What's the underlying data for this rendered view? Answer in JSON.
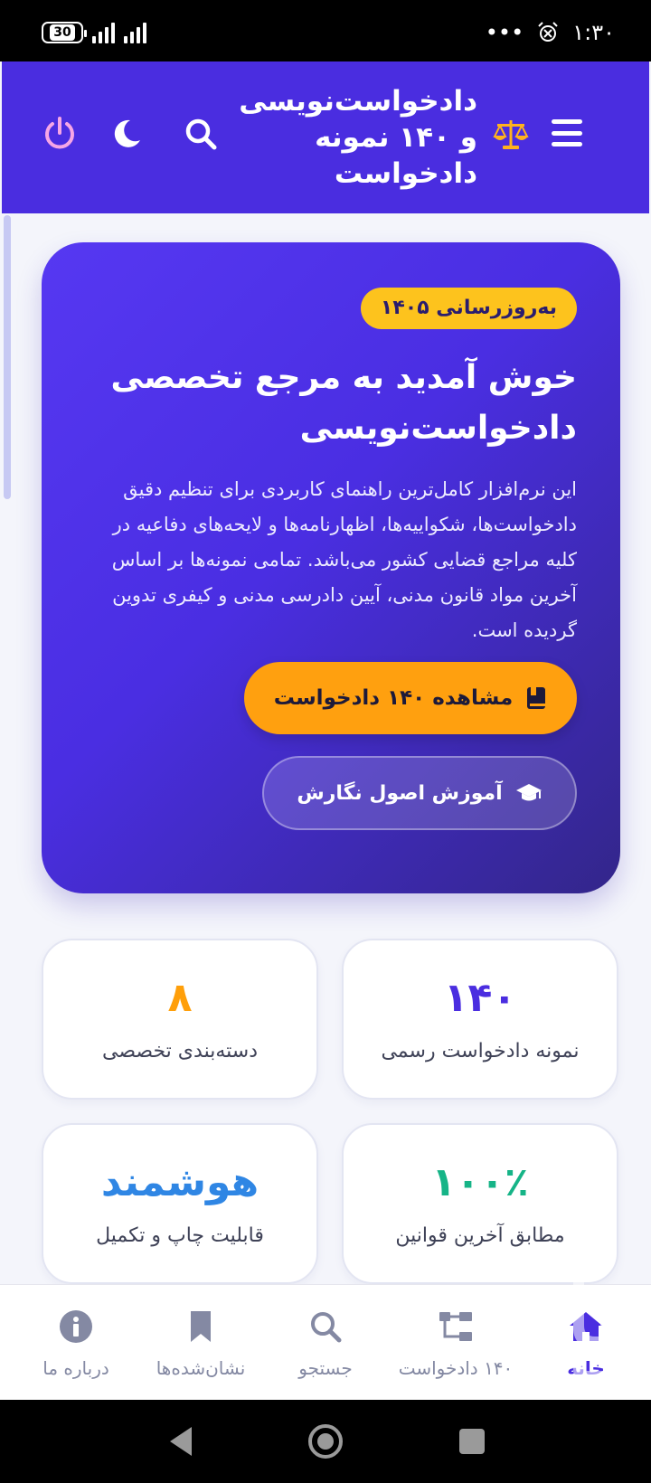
{
  "status_bar": {
    "time": "۱:۳۰",
    "dots": "•••",
    "battery": "30"
  },
  "header": {
    "title": "دادخواست‌نویسی و ۱۴۰ نمونه دادخواست"
  },
  "hero": {
    "badge": "به‌روزرسانی ۱۴۰۵",
    "title": "خوش آمدید به مرجع تخصصی دادخواست‌نویسی",
    "description": "این نرم‌افزار کامل‌ترین راهنمای کاربردی برای تنظیم دقیق دادخواست‌ها، شکواییه‌ها، اظهارنامه‌ها و لایحه‌های دفاعیه در کلیه مراجع قضایی کشور می‌باشد. تمامی نمونه‌ها بر اساس آخرین مواد قانون مدنی، آیین دادرسی مدنی و کیفری تدوین گردیده است.",
    "primary_button": "مشاهده ۱۴۰ دادخواست",
    "secondary_button": "آموزش اصول نگارش"
  },
  "stats": [
    {
      "value": "۱۴۰",
      "label": "نمونه دادخواست رسمی",
      "color": "#4a2de0"
    },
    {
      "value": "۸",
      "label": "دسته‌بندی تخصصی",
      "color": "#ff9f0a"
    },
    {
      "value": "۱۰۰٪",
      "label": "مطابق آخرین قوانین",
      "color": "#16b487"
    },
    {
      "value": "هوشمند",
      "label": "قابلیت چاپ و تکمیل",
      "color": "#2f86e4"
    }
  ],
  "bottom_nav": [
    {
      "label": "خانه",
      "icon": "home-icon",
      "active": true
    },
    {
      "label": "۱۴۰ دادخواست",
      "icon": "sitemap-icon",
      "active": false
    },
    {
      "label": "جستجو",
      "icon": "search-icon",
      "active": false
    },
    {
      "label": "نشان‌شده‌ها",
      "icon": "bookmark-icon",
      "active": false
    },
    {
      "label": "درباره ما",
      "icon": "info-icon",
      "active": false
    }
  ],
  "colors": {
    "brand": "#4a2de0",
    "accent": "#ffa00f",
    "badge": "#fdc31d"
  }
}
